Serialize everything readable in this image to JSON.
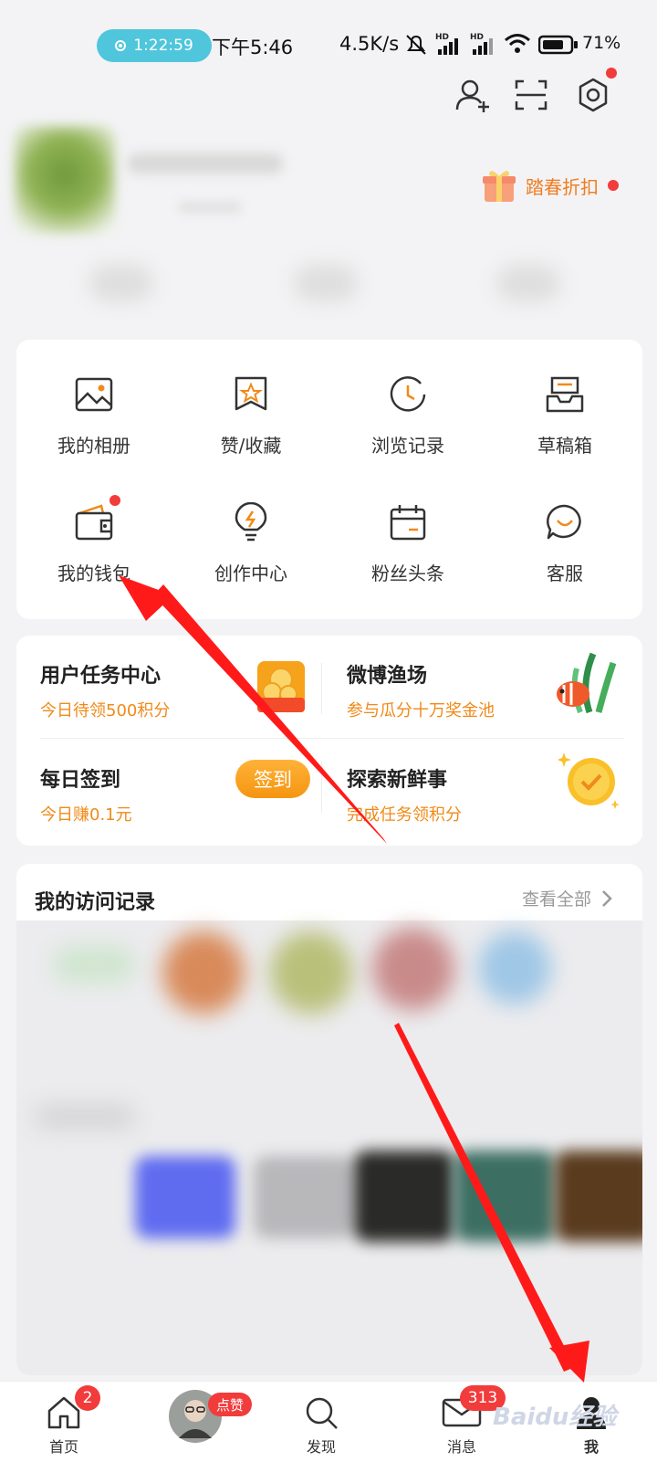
{
  "status": {
    "record_time": "1:22:59",
    "clock": "下午5:46",
    "net_speed": "4.5K/s",
    "hd1": "HD",
    "hd2": "HD",
    "battery": "71%"
  },
  "header": {
    "promo_label": "踏春折扣"
  },
  "grid": {
    "items": [
      {
        "label": "我的相册",
        "icon": "photo-album-icon"
      },
      {
        "label": "赞/收藏",
        "icon": "bookmark-star-icon"
      },
      {
        "label": "浏览记录",
        "icon": "history-clock-icon"
      },
      {
        "label": "草稿箱",
        "icon": "drafts-tray-icon"
      },
      {
        "label": "我的钱包",
        "icon": "wallet-icon"
      },
      {
        "label": "创作中心",
        "icon": "lightbulb-icon"
      },
      {
        "label": "粉丝头条",
        "icon": "calendar-icon"
      },
      {
        "label": "客服",
        "icon": "chat-smile-icon"
      }
    ]
  },
  "tasks": {
    "user_task_title": "用户任务中心",
    "user_task_sub": "今日待领500积分",
    "fishing_title": "微博渔场",
    "fishing_sub": "参与瓜分十万奖金池",
    "checkin_title": "每日签到",
    "checkin_sub": "今日赚0.1元",
    "checkin_button": "签到",
    "explore_title": "探索新鲜事",
    "explore_sub": "完成任务领积分"
  },
  "visits": {
    "title": "我的访问记录",
    "view_all": "查看全部"
  },
  "nav": {
    "home_label": "首页",
    "home_badge": "2",
    "like_badge": "点赞",
    "discover_label": "发现",
    "messages_label": "消息",
    "messages_badge": "313",
    "me_label": "我"
  },
  "watermark": "Baidu经验",
  "colors": {
    "accent_orange": "#f08a18",
    "badge_red": "#f23b3b",
    "annotation_red": "#ff1a1a",
    "record_pill": "#4fc6dc"
  }
}
